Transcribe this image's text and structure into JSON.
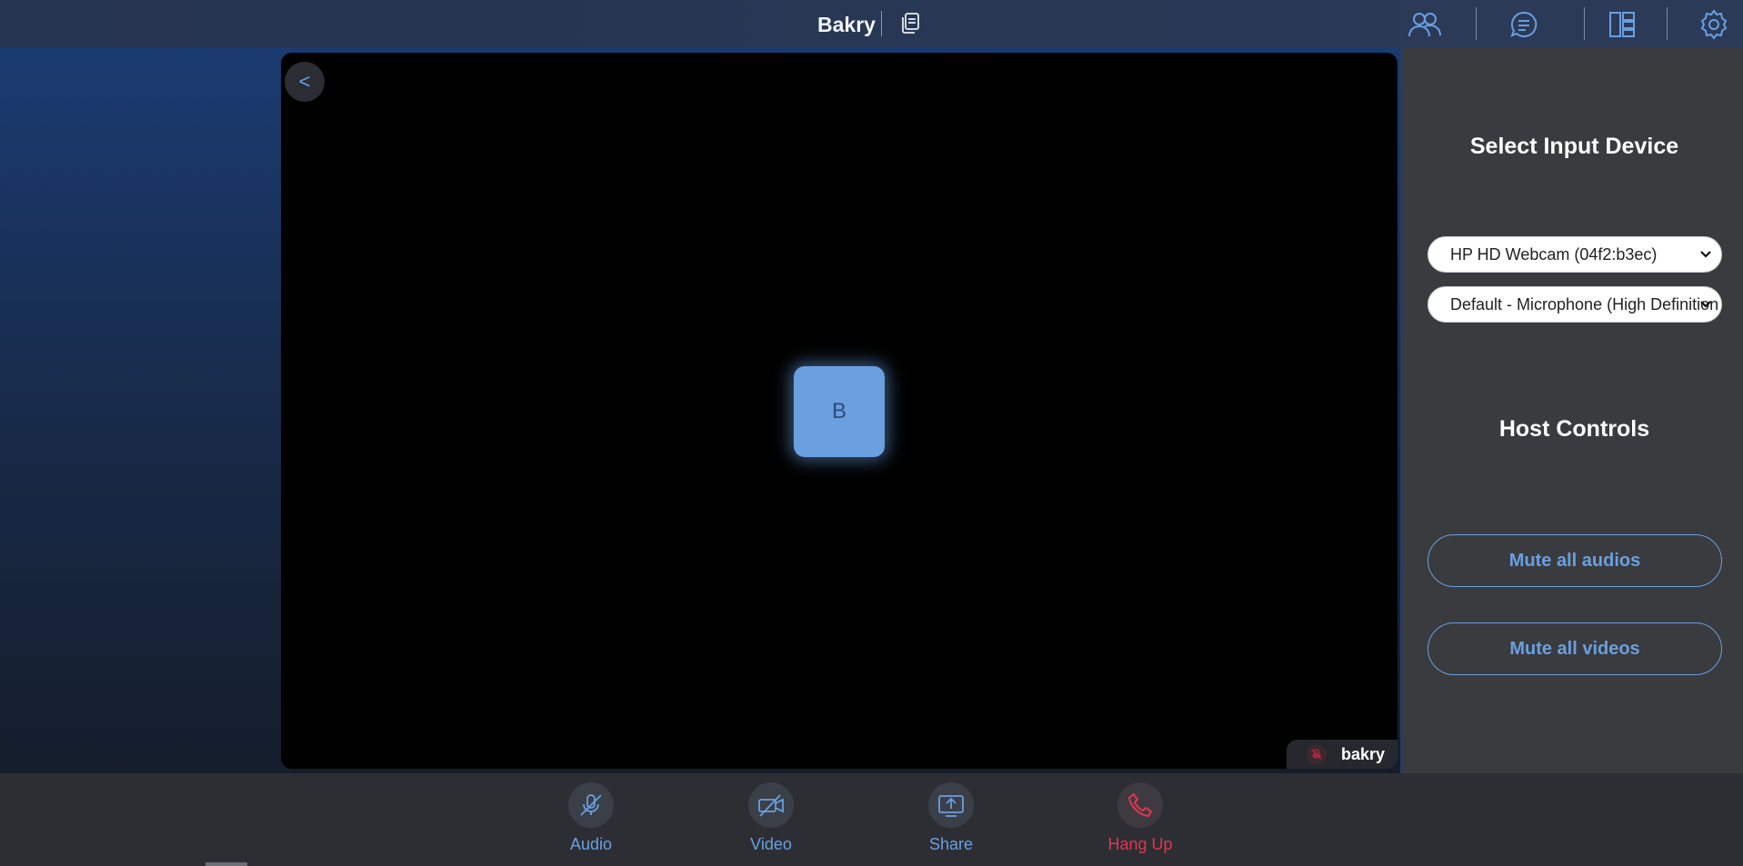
{
  "header": {
    "room_title": "Bakry",
    "icons": [
      "copy-icon",
      "participants-icon",
      "chat-icon",
      "layout-icon",
      "settings-icon"
    ]
  },
  "stage": {
    "collapse_label": "<",
    "avatar_initial": "B",
    "participant_name": "bakry"
  },
  "side_panel": {
    "input_heading": "Select Input Device",
    "camera_select": {
      "value": "HP HD Webcam (04f2:b3ec)"
    },
    "mic_select": {
      "value": "Default - Microphone (High Definition Audio Device)"
    },
    "host_heading": "Host Controls",
    "mute_audios_label": "Mute all audios",
    "mute_videos_label": "Mute all videos"
  },
  "controls": {
    "audio_label": "Audio",
    "video_label": "Video",
    "share_label": "Share",
    "hangup_label": "Hang Up"
  },
  "colors": {
    "accent": "#6a9fe0",
    "danger": "#e53553",
    "panel_bg": "#3a3b3e"
  }
}
